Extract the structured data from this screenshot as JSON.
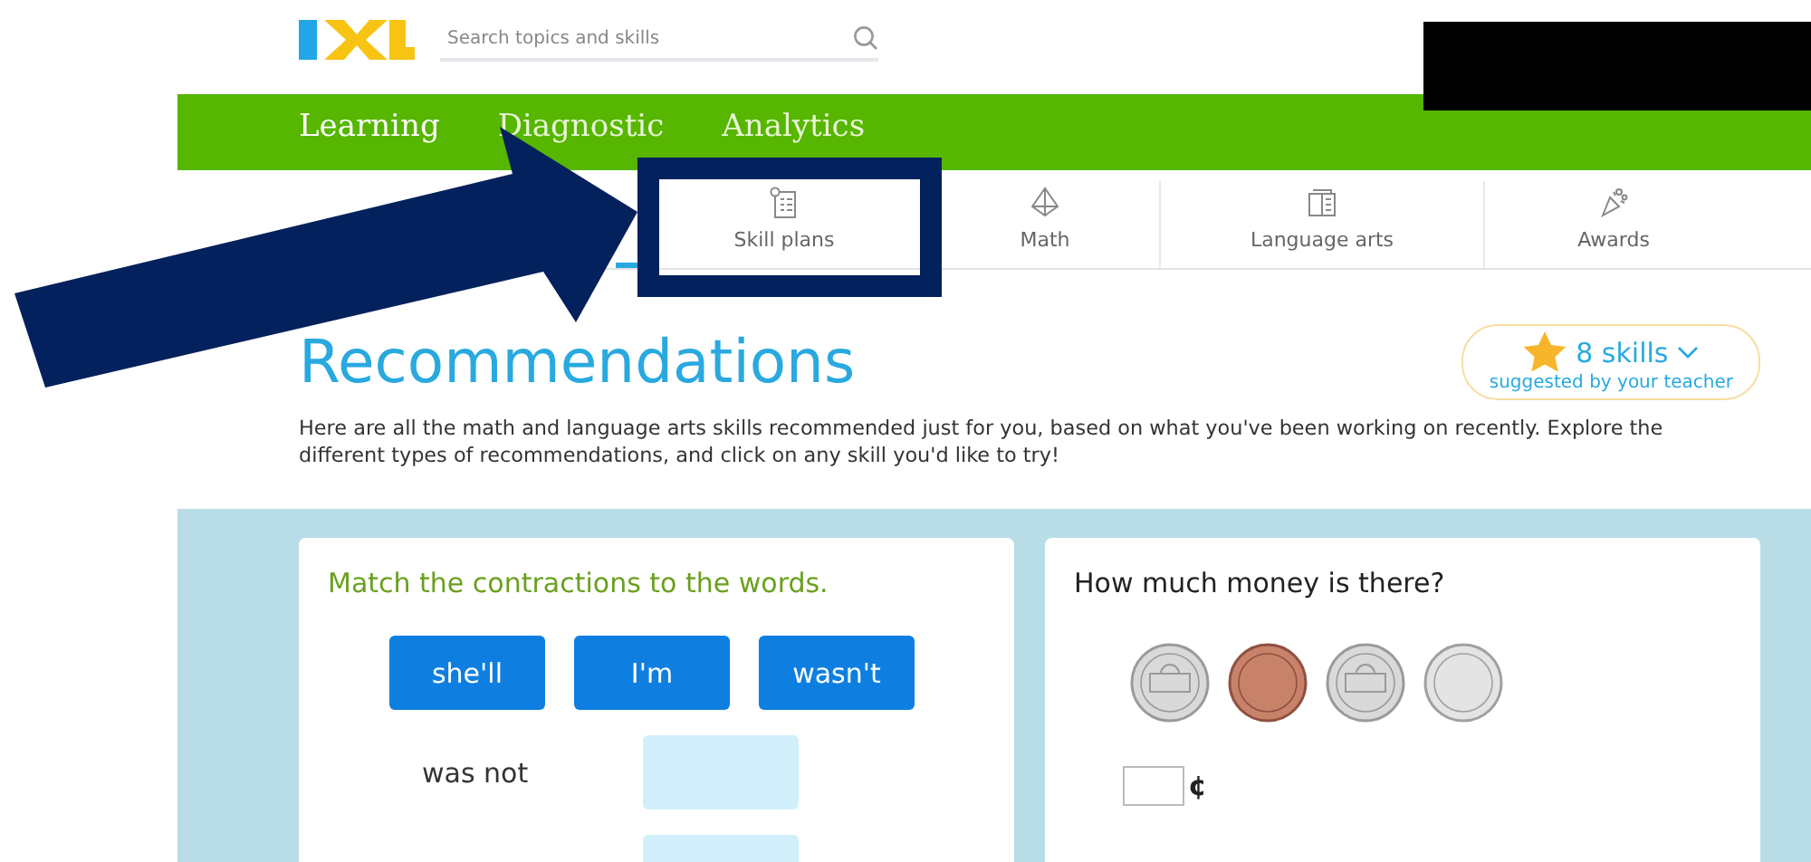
{
  "header": {
    "search": {
      "placeholder": "Search topics and skills"
    }
  },
  "main_nav": [
    {
      "label": "Learning",
      "selected": true
    },
    {
      "label": "Diagnostic",
      "selected": false
    },
    {
      "label": "Analytics",
      "selected": false
    }
  ],
  "sub_nav": [
    {
      "kind": "recommendations",
      "selected": true
    },
    {
      "kind": "skill-plans",
      "label": "Skill plans",
      "selected": false
    },
    {
      "kind": "math",
      "label": "Math",
      "selected": false
    },
    {
      "kind": "language-arts",
      "label": "Language arts",
      "selected": false
    },
    {
      "kind": "awards",
      "label": "Awards",
      "selected": false
    }
  ],
  "page": {
    "title": "Recommendations",
    "description": "Here are all the math and language arts skills recommended just for you, based on what you've been working on recently. Explore the different types of recommendations, and click on any skill you'd like to try!",
    "teacher_badge": {
      "count": "8 skills",
      "subtitle": "suggested by your teacher"
    }
  },
  "cards": [
    {
      "kind": "matching",
      "prompt": "Match the contractions to the words.",
      "choices": [
        "she'll",
        "I'm",
        "wasn't"
      ],
      "rows": [
        {
          "word": "was not"
        },
        {
          "word": ""
        }
      ]
    },
    {
      "kind": "money",
      "prompt": "How much money is there?",
      "coins": [
        {
          "kind": "nickel-back"
        },
        {
          "kind": "penny"
        },
        {
          "kind": "nickel-back"
        },
        {
          "kind": "nickel-front"
        }
      ],
      "unit": "¢"
    }
  ]
}
